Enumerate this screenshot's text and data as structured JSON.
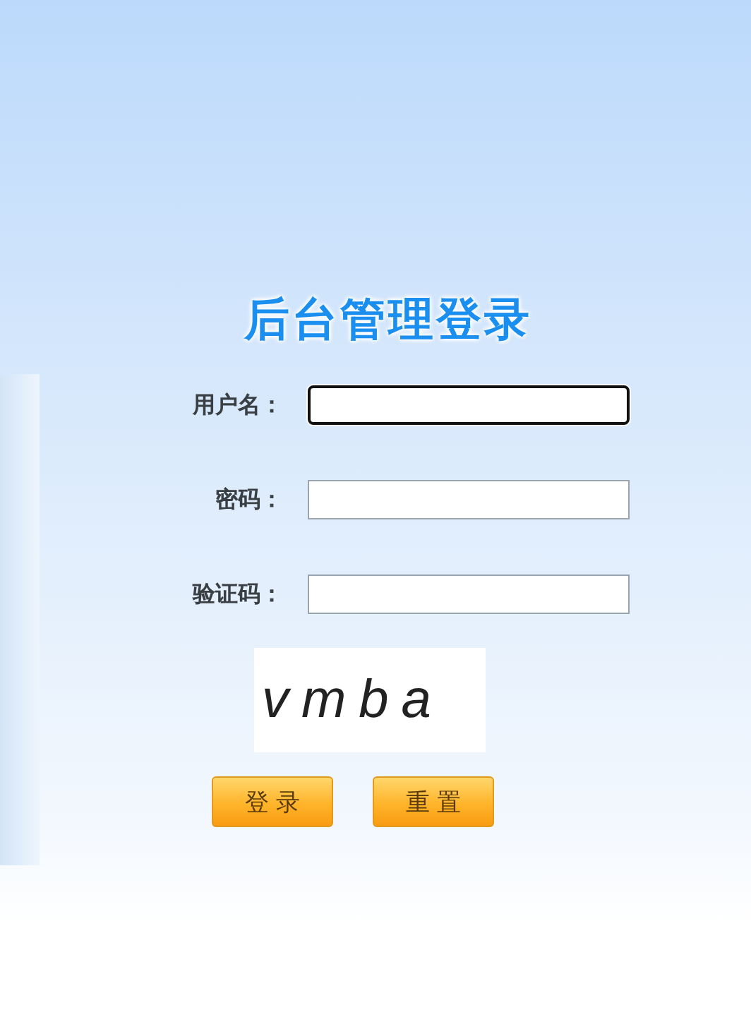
{
  "title": "后台管理登录",
  "fields": [
    {
      "label": "用户名：",
      "focused": true
    },
    {
      "label": "密码：",
      "focused": false
    },
    {
      "label": "验证码：",
      "focused": false
    }
  ],
  "captcha": {
    "text": "vmba"
  },
  "buttons": [
    "登 录",
    "重 置"
  ]
}
